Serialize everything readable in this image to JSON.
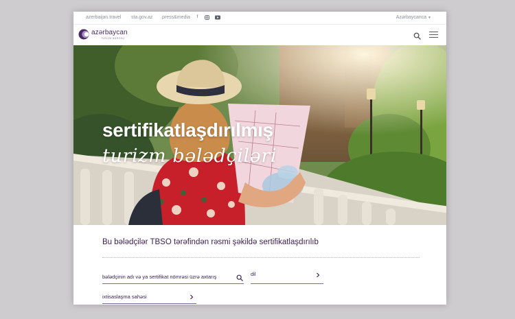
{
  "topbar": {
    "links": [
      "azerbaijan.travel",
      "sta.gov.az",
      "press&media"
    ],
    "social_icons": [
      "facebook-icon",
      "instagram-icon",
      "youtube-icon"
    ],
    "language": "Azərbaycanca"
  },
  "header": {
    "logo_text": "azərbaycan",
    "logo_subtext": "TURİZM BÜROSU",
    "icons": [
      "search-icon",
      "menu-icon"
    ]
  },
  "hero": {
    "title_line1": "sertifikatlaşdırılmış",
    "title_line2": "turizm bələdçiləri"
  },
  "main": {
    "intro": "Bu bələdçilər TBSO tərəfindən rəsmi şəkildə sertifikatlaşdırılıb",
    "search": {
      "label": "bələdçinin adı və ya sertifikat nömrəsi üzrə axtarış"
    },
    "language_filter": {
      "label": "dil"
    },
    "specialization_filter": {
      "label": "ixtisaslaşma sahəsi"
    }
  },
  "colors": {
    "brand_purple": "#4a2a63",
    "text_purple": "#3b2152",
    "backdrop": "#cfcccf"
  }
}
